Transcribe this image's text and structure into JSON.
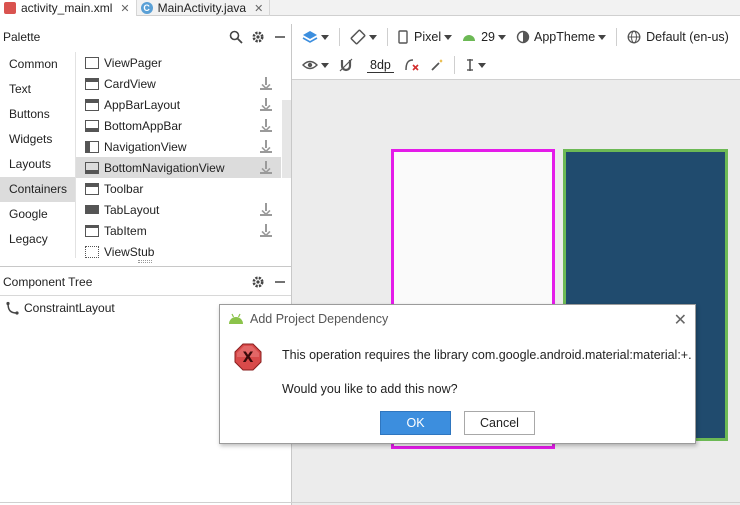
{
  "tabs": [
    {
      "label": "activity_main.xml",
      "icon": "xml-file-icon",
      "active": true
    },
    {
      "label": "MainActivity.java",
      "icon": "java-class-icon",
      "active": false
    }
  ],
  "palette": {
    "title": "Palette",
    "categories": [
      "Common",
      "Text",
      "Buttons",
      "Widgets",
      "Layouts",
      "Containers",
      "Google",
      "Legacy"
    ],
    "selected_category": "Containers",
    "components": [
      {
        "label": "ViewPager",
        "download": false
      },
      {
        "label": "CardView",
        "download": true
      },
      {
        "label": "AppBarLayout",
        "download": true
      },
      {
        "label": "BottomAppBar",
        "download": true
      },
      {
        "label": "NavigationView",
        "download": true
      },
      {
        "label": "BottomNavigationView",
        "download": true
      },
      {
        "label": "Toolbar",
        "download": false
      },
      {
        "label": "TabLayout",
        "download": true
      },
      {
        "label": "TabItem",
        "download": true
      },
      {
        "label": "ViewStub",
        "download": false
      }
    ],
    "selected_component": "BottomNavigationView"
  },
  "component_tree": {
    "title": "Component Tree",
    "root": "ConstraintLayout"
  },
  "toolbar": {
    "device": "Pixel",
    "api": "29",
    "theme": "AppTheme",
    "locale": "Default (en-us)",
    "margin": "8dp"
  },
  "dialog": {
    "title": "Add Project Dependency",
    "message": "This operation requires the library com.google.android.material:material:+.",
    "question": "Would you like to add this now?",
    "ok_label": "OK",
    "cancel_label": "Cancel"
  },
  "colors": {
    "accent": "#3c8ede",
    "blueprint_selected": "#e41be9",
    "blueprint_dark_fill": "#204b6e",
    "blueprint_dark_border": "#6cb955",
    "error_red": "#d32f2f"
  }
}
